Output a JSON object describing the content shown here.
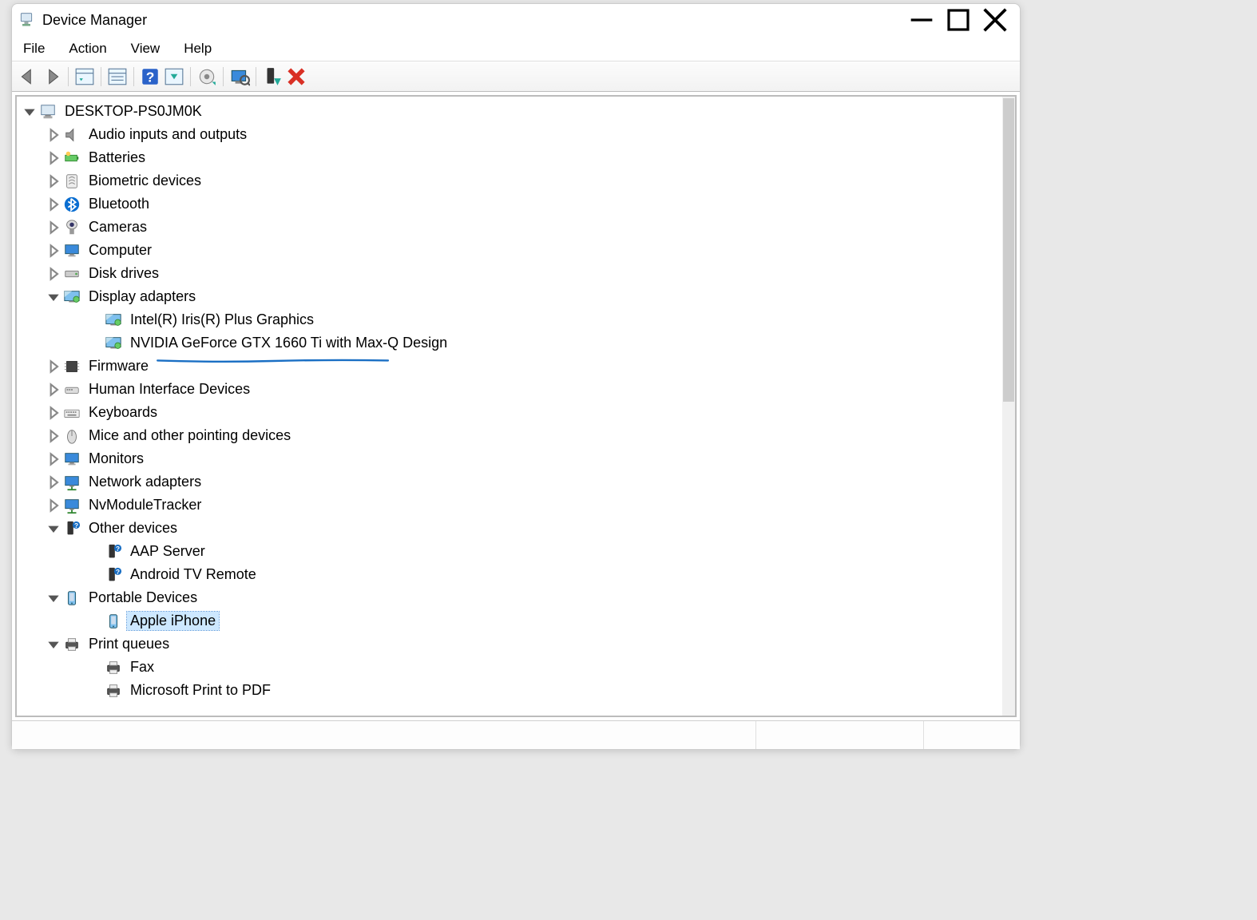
{
  "window": {
    "title": "Device Manager"
  },
  "menu": {
    "file": "File",
    "action": "Action",
    "view": "View",
    "help": "Help"
  },
  "tree": {
    "root": "DESKTOP-PS0JM0K",
    "categories": [
      {
        "label": "Audio inputs and outputs",
        "expanded": false,
        "icon": "speaker"
      },
      {
        "label": "Batteries",
        "expanded": false,
        "icon": "battery"
      },
      {
        "label": "Biometric devices",
        "expanded": false,
        "icon": "fingerprint"
      },
      {
        "label": "Bluetooth",
        "expanded": false,
        "icon": "bluetooth"
      },
      {
        "label": "Cameras",
        "expanded": false,
        "icon": "camera"
      },
      {
        "label": "Computer",
        "expanded": false,
        "icon": "monitor"
      },
      {
        "label": "Disk drives",
        "expanded": false,
        "icon": "disk"
      },
      {
        "label": "Display adapters",
        "expanded": true,
        "icon": "display",
        "children": [
          {
            "label": "Intel(R) Iris(R) Plus Graphics",
            "icon": "display",
            "annot": false
          },
          {
            "label": "NVIDIA GeForce GTX 1660 Ti with Max-Q Design",
            "icon": "display",
            "annot": true
          }
        ]
      },
      {
        "label": "Firmware",
        "expanded": false,
        "icon": "chip"
      },
      {
        "label": "Human Interface Devices",
        "expanded": false,
        "icon": "hid"
      },
      {
        "label": "Keyboards",
        "expanded": false,
        "icon": "keyboard"
      },
      {
        "label": "Mice and other pointing devices",
        "expanded": false,
        "icon": "mouse"
      },
      {
        "label": "Monitors",
        "expanded": false,
        "icon": "monitor"
      },
      {
        "label": "Network adapters",
        "expanded": false,
        "icon": "network"
      },
      {
        "label": "NvModuleTracker",
        "expanded": false,
        "icon": "network"
      },
      {
        "label": "Other devices",
        "expanded": true,
        "icon": "unknown",
        "children": [
          {
            "label": "AAP Server",
            "icon": "unknown"
          },
          {
            "label": "Android TV Remote",
            "icon": "unknown"
          }
        ]
      },
      {
        "label": "Portable Devices",
        "expanded": true,
        "icon": "portable",
        "children": [
          {
            "label": "Apple iPhone",
            "icon": "portable",
            "selected": true
          }
        ]
      },
      {
        "label": "Print queues",
        "expanded": true,
        "icon": "printer",
        "children": [
          {
            "label": "Fax",
            "icon": "printer"
          },
          {
            "label": "Microsoft Print to PDF",
            "icon": "printer"
          }
        ]
      }
    ]
  },
  "annotation": {
    "color": "#1a6fc4"
  }
}
